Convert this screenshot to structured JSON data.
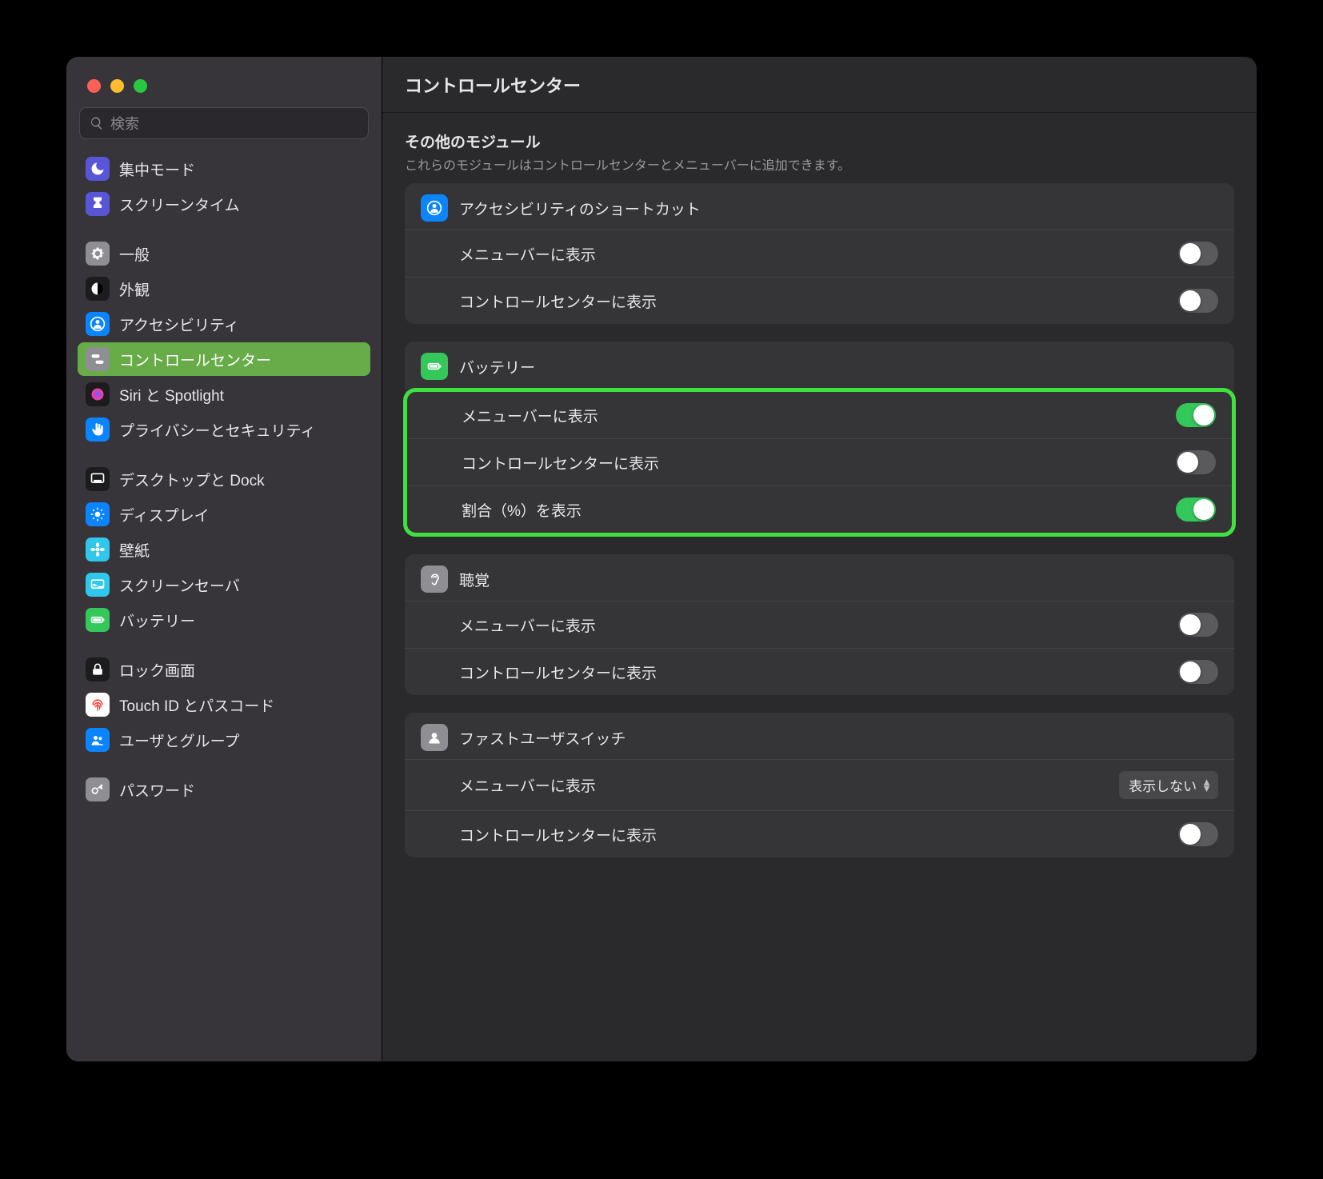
{
  "search": {
    "placeholder": "検索"
  },
  "title": "コントロールセンター",
  "sidebar": {
    "groups": [
      [
        {
          "id": "focus",
          "label": "集中モード",
          "bg": "#5856d6",
          "glyph": "moon"
        },
        {
          "id": "screentime",
          "label": "スクリーンタイム",
          "bg": "#5856d6",
          "glyph": "hourglass"
        }
      ],
      [
        {
          "id": "general",
          "label": "一般",
          "bg": "#8e8e93",
          "glyph": "gear"
        },
        {
          "id": "appearance",
          "label": "外観",
          "bg": "#1c1c1e",
          "glyph": "contrast"
        },
        {
          "id": "accessibility",
          "label": "アクセシビリティ",
          "bg": "#0a84ff",
          "glyph": "person"
        },
        {
          "id": "controlcenter",
          "label": "コントロールセンター",
          "bg": "#8e8e93",
          "glyph": "switches",
          "selected": true
        },
        {
          "id": "siri",
          "label": "Siri と Spotlight",
          "bg": "#1c1c1e",
          "glyph": "siri"
        },
        {
          "id": "privacy",
          "label": "プライバシーとセキュリティ",
          "bg": "#0a84ff",
          "glyph": "hand"
        }
      ],
      [
        {
          "id": "desktop",
          "label": "デスクトップと Dock",
          "bg": "#1c1c1e",
          "glyph": "dock"
        },
        {
          "id": "displays",
          "label": "ディスプレイ",
          "bg": "#0a84ff",
          "glyph": "sun"
        },
        {
          "id": "wallpaper",
          "label": "壁紙",
          "bg": "#30c7ec",
          "glyph": "flower"
        },
        {
          "id": "screensaver",
          "label": "スクリーンセーバ",
          "bg": "#30c7ec",
          "glyph": "screen"
        },
        {
          "id": "battery",
          "label": "バッテリー",
          "bg": "#34c759",
          "glyph": "battery"
        }
      ],
      [
        {
          "id": "lock",
          "label": "ロック画面",
          "bg": "#1c1c1e",
          "glyph": "lock"
        },
        {
          "id": "touchid",
          "label": "Touch ID とパスコード",
          "bg": "#ffffff",
          "glyph": "fingerprint",
          "fg": "#ff3b30"
        },
        {
          "id": "users",
          "label": "ユーザとグループ",
          "bg": "#0a84ff",
          "glyph": "people"
        }
      ],
      [
        {
          "id": "passwords",
          "label": "パスワード",
          "bg": "#8e8e93",
          "glyph": "key"
        }
      ]
    ]
  },
  "section": {
    "title": "その他のモジュール",
    "subtitle": "これらのモジュールはコントロールセンターとメニューバーに追加できます。"
  },
  "modules": [
    {
      "id": "a11y-shortcuts",
      "title": "アクセシビリティのショートカット",
      "iconBg": "#0a84ff",
      "glyph": "person",
      "rows": [
        {
          "label": "メニューバーに表示",
          "type": "toggle",
          "on": false
        },
        {
          "label": "コントロールセンターに表示",
          "type": "toggle",
          "on": false
        }
      ]
    },
    {
      "id": "battery",
      "title": "バッテリー",
      "iconBg": "#34c759",
      "glyph": "battery",
      "highlight": true,
      "rows": [
        {
          "label": "メニューバーに表示",
          "type": "toggle",
          "on": true
        },
        {
          "label": "コントロールセンターに表示",
          "type": "toggle",
          "on": false
        },
        {
          "label": "割合（%）を表示",
          "type": "toggle",
          "on": true
        }
      ]
    },
    {
      "id": "hearing",
      "title": "聴覚",
      "iconBg": "#8e8e93",
      "glyph": "ear",
      "rows": [
        {
          "label": "メニューバーに表示",
          "type": "toggle",
          "on": false
        },
        {
          "label": "コントロールセンターに表示",
          "type": "toggle",
          "on": false
        }
      ]
    },
    {
      "id": "fast-user-switch",
      "title": "ファストユーザスイッチ",
      "iconBg": "#8e8e93",
      "glyph": "user",
      "rows": [
        {
          "label": "メニューバーに表示",
          "type": "select",
          "value": "表示しない"
        },
        {
          "label": "コントロールセンターに表示",
          "type": "toggle",
          "on": false
        }
      ]
    }
  ]
}
